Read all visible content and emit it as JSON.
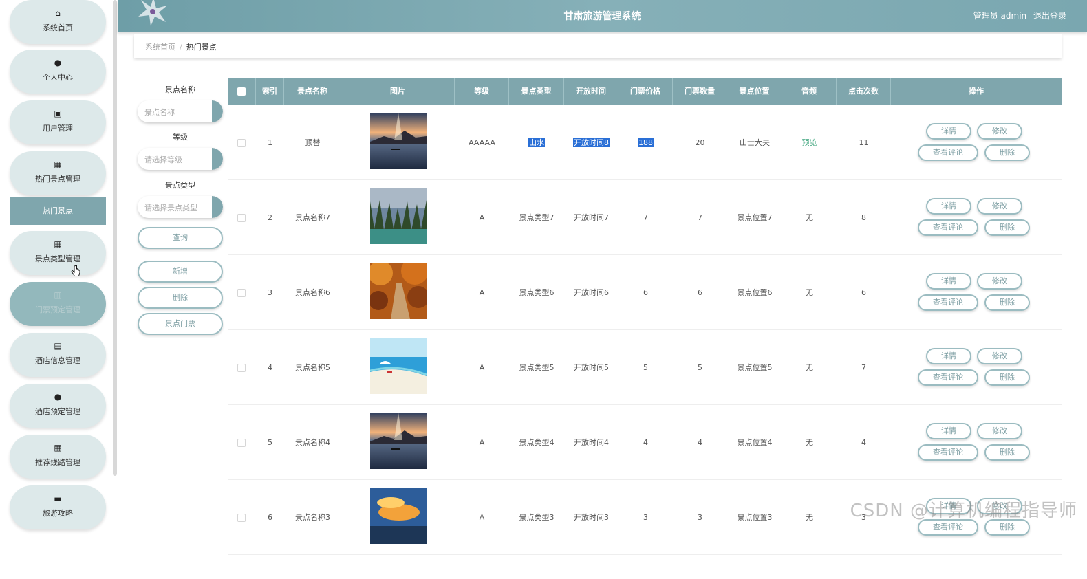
{
  "header": {
    "title": "甘肃旅游管理系统",
    "user_text": "管理员 admin",
    "logout_label": "退出登录"
  },
  "sidebar": {
    "items": [
      {
        "label": "系统首页",
        "icon": "home-icon",
        "glyph": "⌂"
      },
      {
        "label": "个人中心",
        "icon": "user-icon",
        "glyph": "●"
      },
      {
        "label": "用户管理",
        "icon": "briefcase-icon",
        "glyph": "▣"
      },
      {
        "label": "热门景点管理",
        "icon": "grid-icon",
        "glyph": "▦"
      },
      {
        "label": "景点类型管理",
        "icon": "grid-icon",
        "glyph": "▦"
      },
      {
        "label": "门票预定管理",
        "icon": "bar-chart-icon",
        "glyph": "▥"
      },
      {
        "label": "酒店信息管理",
        "icon": "clipboard-icon",
        "glyph": "▤"
      },
      {
        "label": "酒店预定管理",
        "icon": "pin-icon",
        "glyph": "●"
      },
      {
        "label": "推荐线路管理",
        "icon": "grid-icon",
        "glyph": "▦"
      },
      {
        "label": "旅游攻略",
        "icon": "monitor-icon",
        "glyph": "▬"
      }
    ],
    "active_sub": "热门景点"
  },
  "breadcrumb": {
    "home": "系统首页",
    "separator": "/",
    "current": "热门景点"
  },
  "filters": {
    "name_label": "景点名称",
    "name_placeholder": "景点名称",
    "level_label": "等级",
    "level_placeholder": "请选择等级",
    "type_label": "景点类型",
    "type_placeholder": "请选择景点类型",
    "query_button": "查询",
    "add_button": "新增",
    "delete_button": "删除",
    "ticket_button": "景点门票"
  },
  "table": {
    "columns": [
      "索引",
      "景点名称",
      "图片",
      "等级",
      "景点类型",
      "开放时间",
      "门票价格",
      "门票数量",
      "景点位置",
      "音频",
      "点击次数",
      "操作"
    ],
    "rows": [
      {
        "index": "1",
        "name": "顶替",
        "image": "lake-sunset",
        "level": "AAAAA",
        "type": "山水",
        "open": "开放时间8",
        "price": "188",
        "qty": "20",
        "location": "山士大夫",
        "audio": "预览",
        "clicks": "11"
      },
      {
        "index": "2",
        "name": "景点名称7",
        "image": "river-forest",
        "level": "A",
        "type": "景点类型7",
        "open": "开放时间7",
        "price": "7",
        "qty": "7",
        "location": "景点位置7",
        "audio": "无",
        "clicks": "8"
      },
      {
        "index": "3",
        "name": "景点名称6",
        "image": "autumn-path",
        "level": "A",
        "type": "景点类型6",
        "open": "开放时间6",
        "price": "6",
        "qty": "6",
        "location": "景点位置6",
        "audio": "无",
        "clicks": "6"
      },
      {
        "index": "4",
        "name": "景点名称5",
        "image": "beach",
        "level": "A",
        "type": "景点类型5",
        "open": "开放时间5",
        "price": "5",
        "qty": "5",
        "location": "景点位置5",
        "audio": "无",
        "clicks": "7"
      },
      {
        "index": "5",
        "name": "景点名称4",
        "image": "lake-sunset",
        "level": "A",
        "type": "景点类型4",
        "open": "开放时间4",
        "price": "4",
        "qty": "4",
        "location": "景点位置4",
        "audio": "无",
        "clicks": "4"
      },
      {
        "index": "6",
        "name": "景点名称3",
        "image": "sunset-sky",
        "level": "A",
        "type": "景点类型3",
        "open": "开放时间3",
        "price": "3",
        "qty": "3",
        "location": "景点位置3",
        "audio": "无",
        "clicks": "3"
      }
    ],
    "actions": {
      "detail": "详情",
      "edit": "修改",
      "comments": "查看评论",
      "delete": "删除"
    }
  },
  "watermark": "CSDN @计算机编程指导师",
  "colors": {
    "accent": "#7fa6ad",
    "menu_bg": "#dde9ea",
    "highlight": "#2a6fd6"
  }
}
